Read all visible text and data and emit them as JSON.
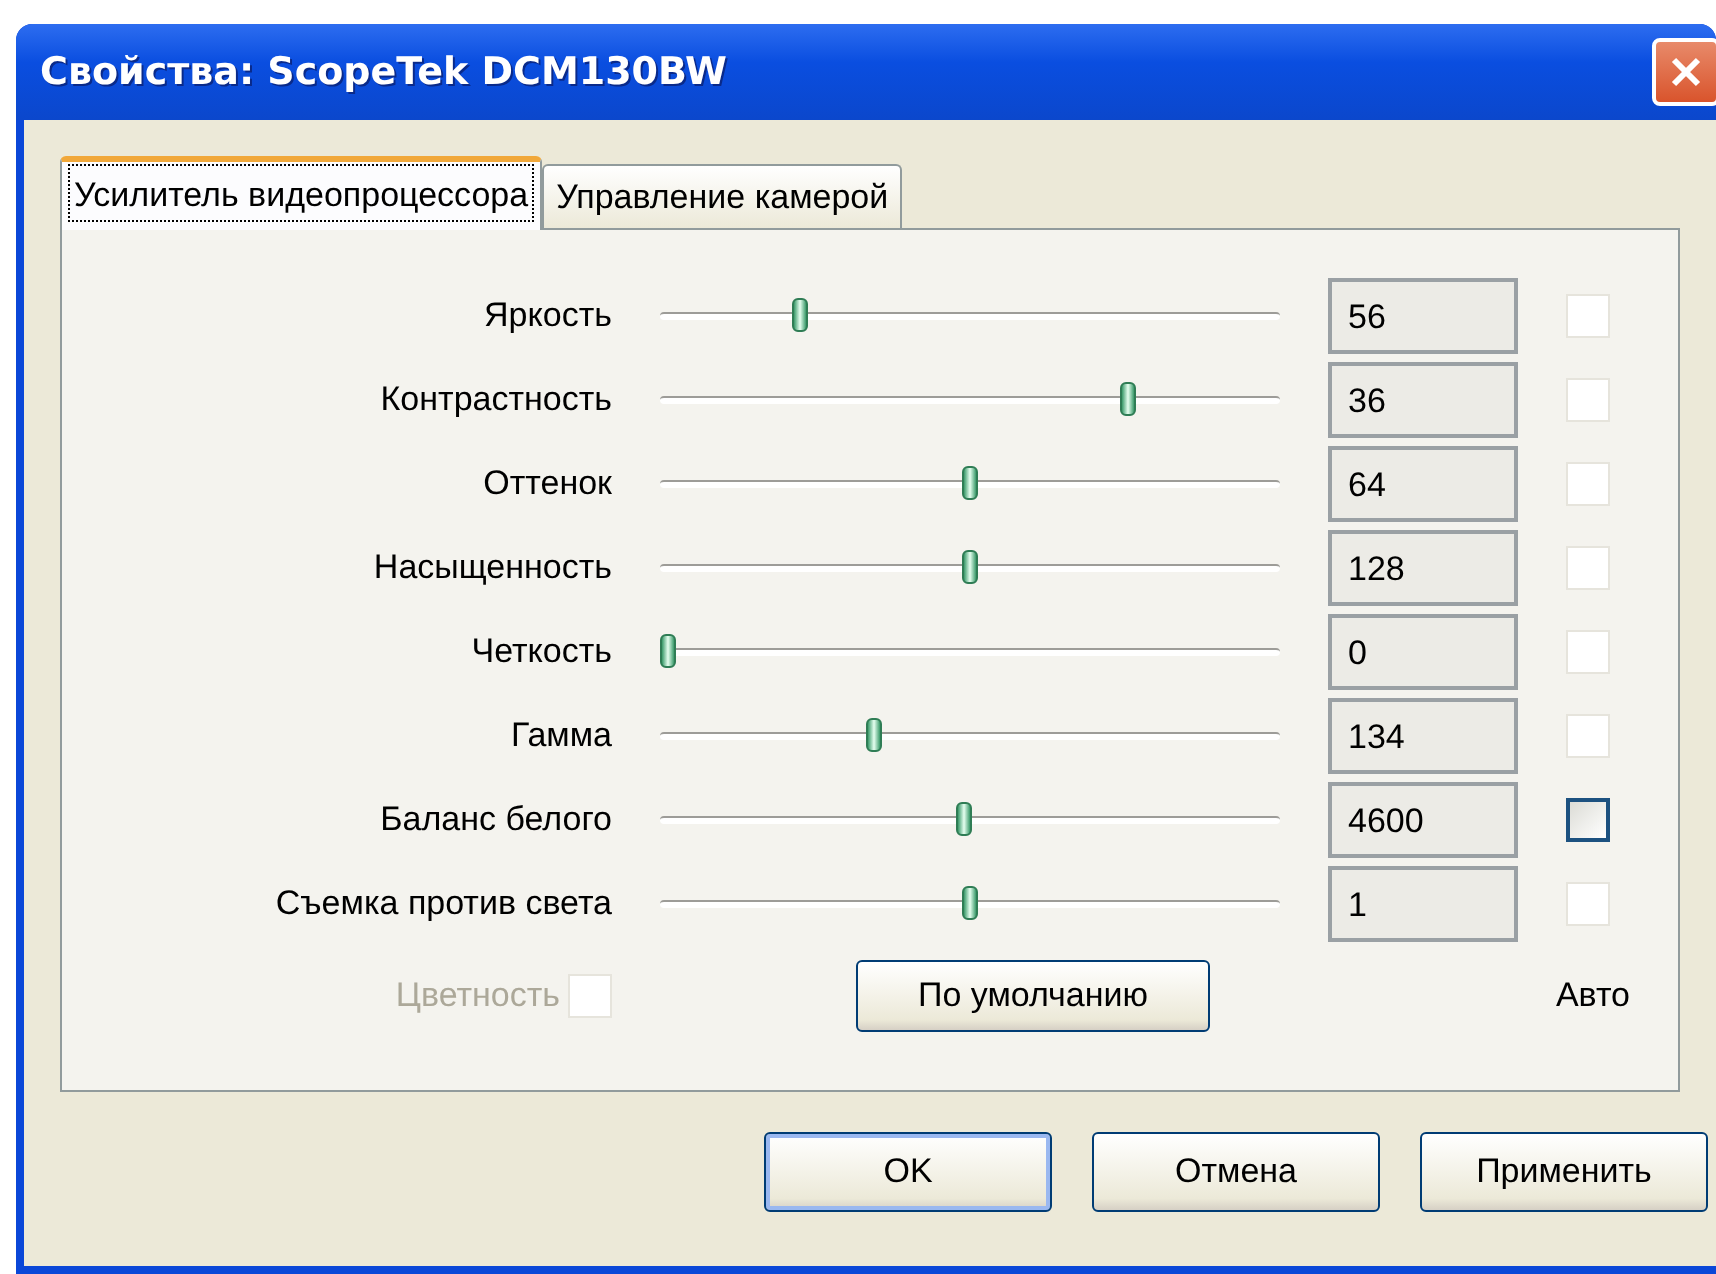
{
  "window": {
    "title": "Свойства: ScopeTek DCM130BW"
  },
  "tabs": [
    {
      "label": "Усилитель видеопроцессора",
      "selected": true
    },
    {
      "label": "Управление камерой",
      "selected": false
    }
  ],
  "controls": [
    {
      "label": "Яркость",
      "level": 0.22,
      "value": "56",
      "auto_checked": false,
      "auto_disabled": true
    },
    {
      "label": "Контрастность",
      "level": 0.76,
      "value": "36",
      "auto_checked": false,
      "auto_disabled": true
    },
    {
      "label": "Оттенок",
      "level": 0.5,
      "value": "64",
      "auto_checked": false,
      "auto_disabled": true
    },
    {
      "label": "Насыщенность",
      "level": 0.5,
      "value": "128",
      "auto_checked": false,
      "auto_disabled": true
    },
    {
      "label": "Четкость",
      "level": 0,
      "value": "0",
      "auto_checked": false,
      "auto_disabled": true
    },
    {
      "label": "Гамма",
      "level": 0.34,
      "value": "134",
      "auto_checked": false,
      "auto_disabled": true
    },
    {
      "label": "Баланс белого",
      "level": 0.49,
      "value": "4600",
      "auto_checked": false,
      "auto_disabled": false
    },
    {
      "label": "Съемка против света",
      "level": 0.5,
      "value": "1",
      "auto_checked": false,
      "auto_disabled": true
    }
  ],
  "color_enable": {
    "label": "Цветность",
    "checked": false,
    "disabled": true
  },
  "default_button": "По умолчанию",
  "auto_label": "Авто",
  "buttons": [
    "OK",
    "Отмена",
    "Применить"
  ]
}
